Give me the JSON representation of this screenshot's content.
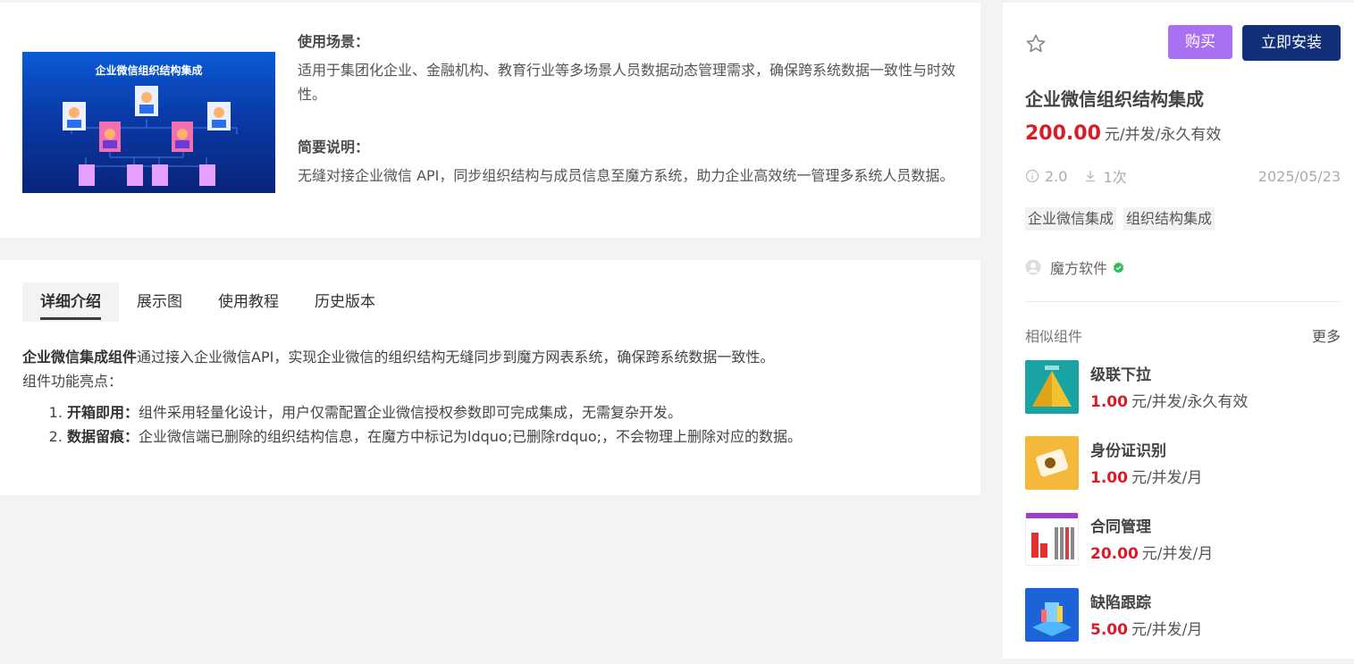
{
  "detail": {
    "thumbnail_title": "企业微信组织结构集成",
    "usage_heading": "使用场景：",
    "usage_text": "适用于集团化企业、金融机构、教育行业等多场景人员数据动态管理需求，确保跨系统数据一致性与时效性。",
    "summary_heading": "简要说明：",
    "summary_text": "无缝对接企业微信 API，同步组织结构与成员信息至魔方系统，助力企业高效统一管理多系统人员数据。"
  },
  "tabs": [
    {
      "label": "详细介绍",
      "active": true
    },
    {
      "label": "展示图",
      "active": false
    },
    {
      "label": "使用教程",
      "active": false
    },
    {
      "label": "历史版本",
      "active": false
    }
  ],
  "intro": {
    "lead_bold": "企业微信集成组件",
    "lead_text": "通过接入企业微信API，实现企业微信的组织结构无缝同步到魔方网表系统，确保跨系统数据一致性。",
    "highlights_label": "组件功能亮点：",
    "items": [
      {
        "bold": "开箱即用：",
        "text": "组件采用轻量化设计，用户仅需配置企业微信授权参数即可完成集成，无需复杂开发。"
      },
      {
        "bold": "数据留痕：",
        "text": "企业微信端已删除的组织结构信息，在魔方中标记为ldquo;已删除rdquo;，不会物理上删除对应的数据。"
      }
    ]
  },
  "sidebar": {
    "buy_label": "购买",
    "install_label": "立即安装",
    "title": "企业微信组织结构集成",
    "price": "200.00",
    "price_unit": "元/并发/永久有效",
    "version": "2.0",
    "downloads": "1次",
    "date": "2025/05/23",
    "tags": [
      "企业微信集成",
      "组织结构集成"
    ],
    "author": "魔方软件",
    "similar_heading": "相似组件",
    "more_label": "更多",
    "similar": [
      {
        "name": "级联下拉",
        "price": "1.00",
        "unit": "元/并发/永久有效",
        "thumb_color": "#1aa3a3"
      },
      {
        "name": "身份证识别",
        "price": "1.00",
        "unit": "元/并发/月",
        "thumb_color": "#f4b93a"
      },
      {
        "name": "合同管理",
        "price": "20.00",
        "unit": "元/并发/月",
        "thumb_color": "#ffffff"
      },
      {
        "name": "缺陷跟踪",
        "price": "5.00",
        "unit": "元/并发/月",
        "thumb_color": "#1d63d8"
      }
    ]
  },
  "colors": {
    "accent_purple": "#a970f2",
    "install_navy": "#12307a",
    "price_red": "#d91c25"
  }
}
